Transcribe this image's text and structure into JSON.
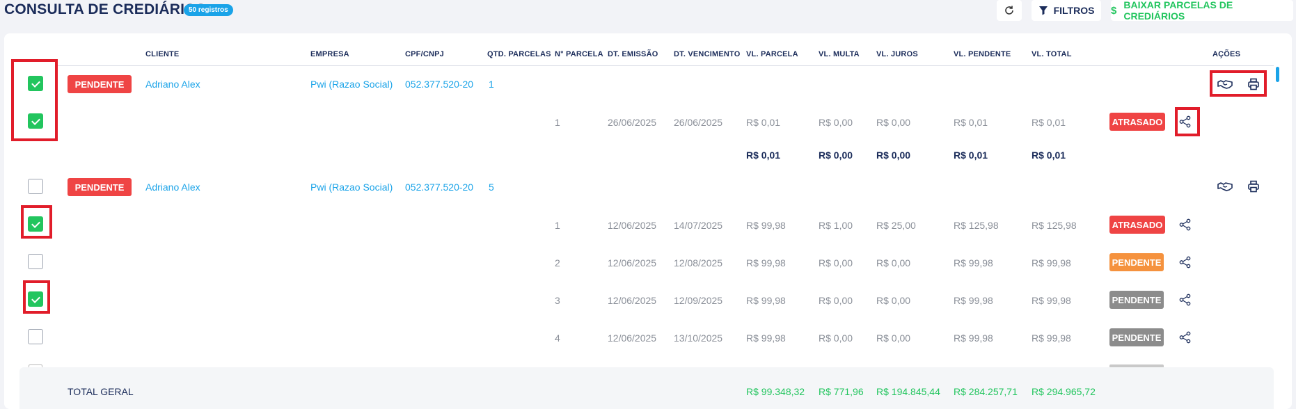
{
  "header": {
    "title": "CONSULTA DE CREDIÁRIOS",
    "count_badge": "50 registros",
    "filter_label": "FILTROS",
    "baixar_label": "BAIXAR PARCELAS DE CREDIÁRIOS"
  },
  "columns": {
    "cliente": "CLIENTE",
    "empresa": "EMPRESA",
    "cpf": "CPF/CNPJ",
    "qtd": "QTD. PARCELAS",
    "n_parcela": "N° PARCELA",
    "dt_emissao": "DT. EMISSÃO",
    "dt_vencimento": "DT. VENCIMENTO",
    "vl_parcela": "VL. PARCELA",
    "vl_multa": "VL. MULTA",
    "vl_juros": "VL. JUROS",
    "vl_pendente": "VL. PENDENTE",
    "vl_total": "VL. TOTAL",
    "acoes": "AÇÕES"
  },
  "groups": [
    {
      "status": "PENDENTE",
      "cliente": "Adriano Alex",
      "empresa": "Pwi (Razao Social)",
      "cpf": "052.377.520-20",
      "qtd": "1",
      "checked": true,
      "installments": [
        {
          "n": "1",
          "emissao": "26/06/2025",
          "vencimento": "26/06/2025",
          "parcela": "R$ 0,01",
          "multa": "R$ 0,00",
          "juros": "R$ 0,00",
          "pendente": "R$ 0,01",
          "total": "R$ 0,01",
          "status": "ATRASADO",
          "checked": true
        }
      ],
      "subtotal": {
        "parcela": "R$ 0,01",
        "multa": "R$ 0,00",
        "juros": "R$ 0,00",
        "pendente": "R$ 0,01",
        "total": "R$ 0,01"
      }
    },
    {
      "status": "PENDENTE",
      "cliente": "Adriano Alex",
      "empresa": "Pwi (Razao Social)",
      "cpf": "052.377.520-20",
      "qtd": "5",
      "checked": false,
      "installments": [
        {
          "n": "1",
          "emissao": "12/06/2025",
          "vencimento": "14/07/2025",
          "parcela": "R$ 99,98",
          "multa": "R$ 1,00",
          "juros": "R$ 25,00",
          "pendente": "R$ 125,98",
          "total": "R$ 125,98",
          "status": "ATRASADO",
          "checked": true
        },
        {
          "n": "2",
          "emissao": "12/06/2025",
          "vencimento": "12/08/2025",
          "parcela": "R$ 99,98",
          "multa": "R$ 0,00",
          "juros": "R$ 0,00",
          "pendente": "R$ 99,98",
          "total": "R$ 99,98",
          "status": "PENDENTE",
          "checked": false
        },
        {
          "n": "3",
          "emissao": "12/06/2025",
          "vencimento": "12/09/2025",
          "parcela": "R$ 99,98",
          "multa": "R$ 0,00",
          "juros": "R$ 0,00",
          "pendente": "R$ 99,98",
          "total": "R$ 99,98",
          "status": "PENDENTE",
          "checked": true
        },
        {
          "n": "4",
          "emissao": "12/06/2025",
          "vencimento": "13/10/2025",
          "parcela": "R$ 99,98",
          "multa": "R$ 0,00",
          "juros": "R$ 0,00",
          "pendente": "R$ 99,98",
          "total": "R$ 99,98",
          "status": "PENDENTE",
          "checked": false
        }
      ]
    }
  ],
  "footer": {
    "label": "TOTAL GERAL",
    "parcela": "R$ 99.348,32",
    "multa": "R$ 771,96",
    "juros": "R$ 194.845,44",
    "pendente": "R$ 284.257,71",
    "total": "R$ 294.965,72"
  },
  "colors": {
    "accent": "#1aa3e8",
    "success": "#22c55e",
    "danger": "#ef4444",
    "warning": "#f5923e",
    "muted": "#8c8c8c",
    "highlight": "#e11d2a"
  },
  "icons": [
    "refresh-icon",
    "filter-icon",
    "dollar-icon",
    "handshake-icon",
    "printer-icon",
    "share-icon"
  ]
}
